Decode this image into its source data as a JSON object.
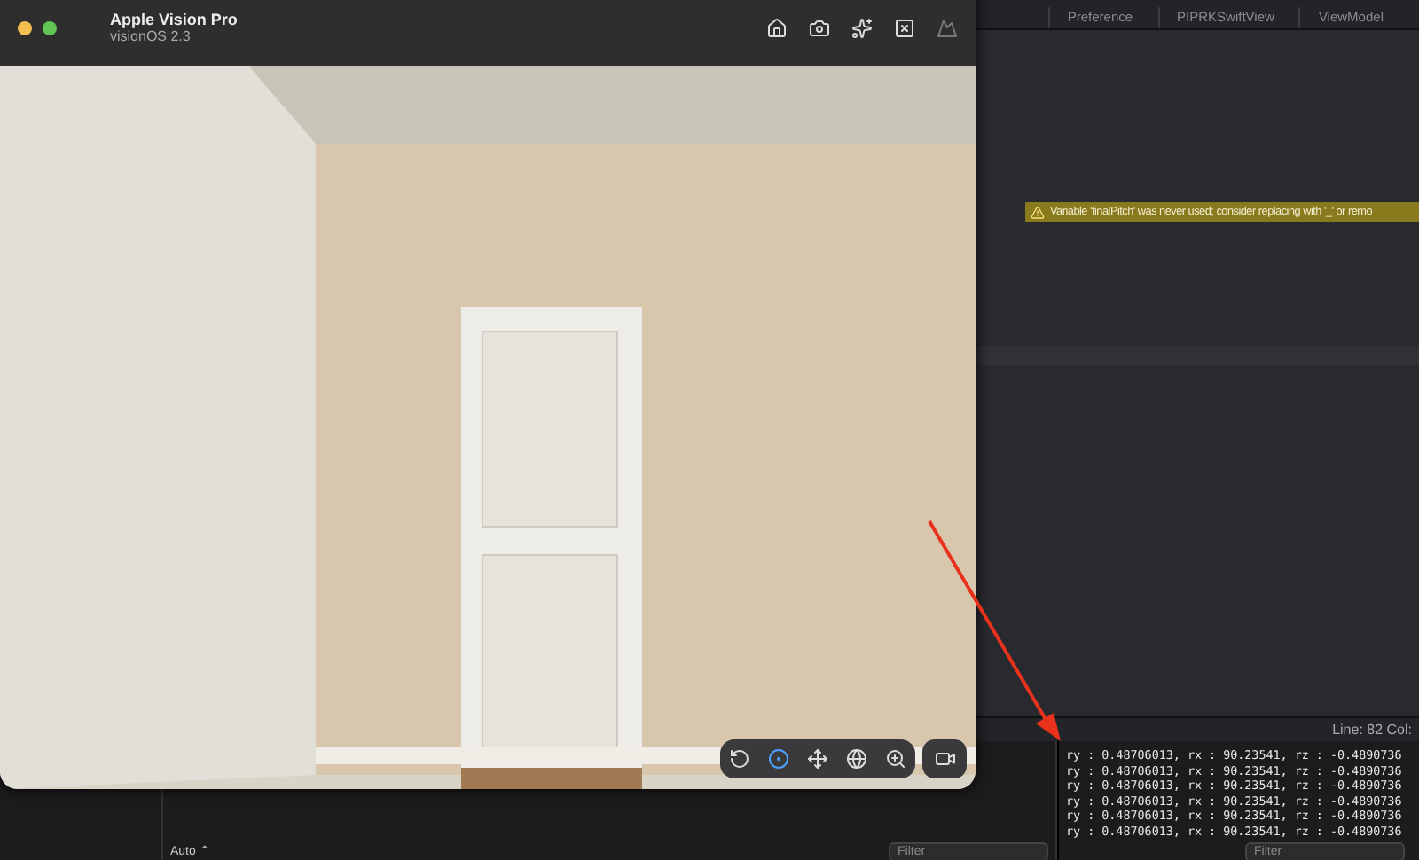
{
  "xcode": {
    "tabs": [
      {
        "label": "Preference"
      },
      {
        "label": "PIPRKSwiftView"
      },
      {
        "label": "ViewModel"
      }
    ],
    "warning": "Variable 'finalPitch' was never used; consider replacing with '_' or remo",
    "status": "Line: 82  Col:",
    "console_lines": [
      "ry : 0.48706013, rx : 90.23541, rz : -0.4890736",
      "ry : 0.48706013, rx : 90.23541, rz : -0.4890736",
      "ry : 0.48706013, rx : 90.23541, rz : -0.4890736",
      "ry : 0.48706013, rx : 90.23541, rz : -0.4890736",
      "ry : 0.48706013, rx : 90.23541, rz : -0.4890736",
      "ry : 0.48706013, rx : 90.23541, rz : -0.4890736"
    ],
    "scheme": "Auto ⌃",
    "filters": [
      {
        "placeholder": "Filter"
      },
      {
        "placeholder": "Filter"
      }
    ]
  },
  "simulator": {
    "title": "Apple Vision Pro",
    "subtitle": "visionOS 2.3"
  }
}
